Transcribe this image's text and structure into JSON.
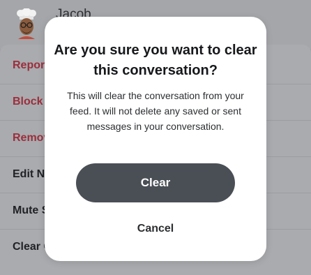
{
  "header": {
    "name": "Jacob",
    "avatar_icon": "bitmoji-chef-avatar-icon"
  },
  "menu": {
    "items": [
      {
        "label": "Report",
        "color": "#9c2e3c"
      },
      {
        "label": "Block",
        "color": "#9c2e3c"
      },
      {
        "label": "Remove",
        "color": "#9c2e3c"
      },
      {
        "label": "Edit N",
        "color": "#202226"
      },
      {
        "label": "Mute S",
        "color": "#202226"
      },
      {
        "label": "Clear C",
        "color": "#202226"
      }
    ]
  },
  "dialog": {
    "title": "Are you sure you want to clear this conversation?",
    "message": "This will clear the conversation from your feed. It will not delete any saved or sent messages in your conversation.",
    "confirm_label": "Clear",
    "cancel_label": "Cancel"
  },
  "colors": {
    "confirm_button": "#4a4f56",
    "dialog_background": "#ffffff",
    "overlay": "#9ea1a5",
    "destructive_text": "#9c2e3c"
  }
}
